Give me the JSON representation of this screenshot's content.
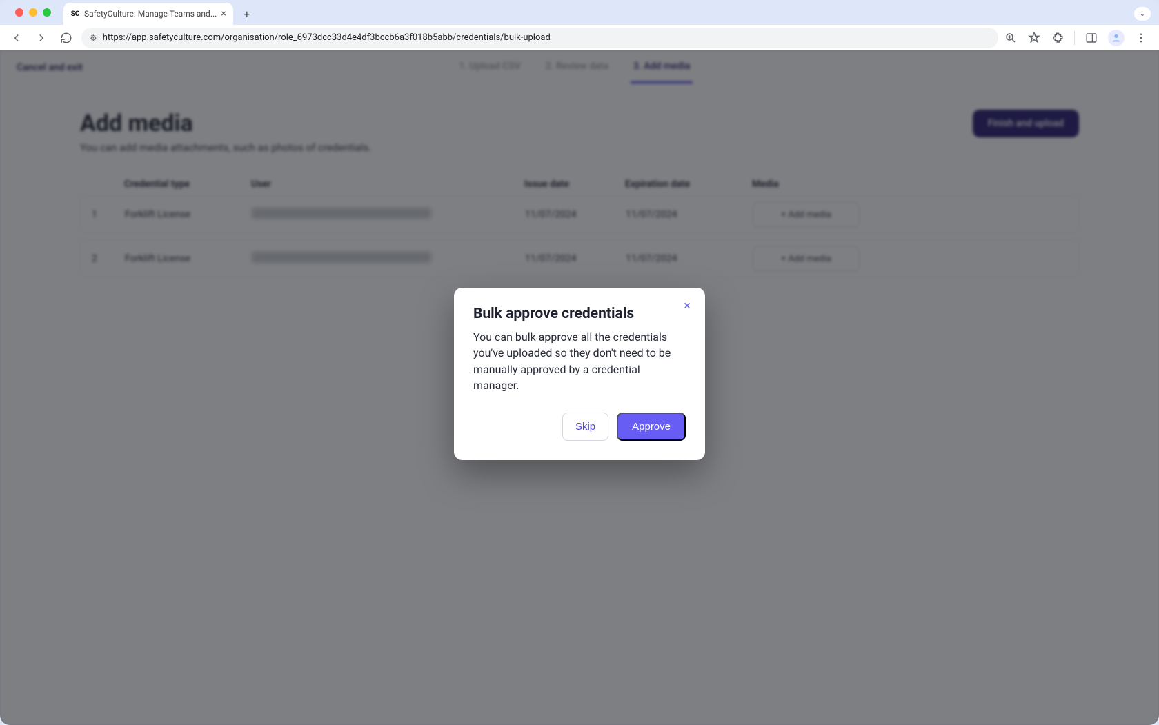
{
  "browser": {
    "tab_title": "SafetyCulture: Manage Teams and...",
    "url": "https://app.safetyculture.com/organisation/role_6973dcc33d4e4df3bccb6a3f018b5abb/credentials/bulk-upload"
  },
  "header": {
    "cancel": "Cancel and exit",
    "steps": [
      "1. Upload CSV",
      "2. Review data",
      "3. Add media"
    ],
    "active_step_index": 2
  },
  "page": {
    "title": "Add media",
    "subtitle": "You can add media attachments, such as photos of credentials.",
    "finish_btn": "Finish and upload"
  },
  "table": {
    "headers": {
      "type": "Credential type",
      "user": "User",
      "issue": "Issue date",
      "exp": "Expiration date",
      "media": "Media"
    },
    "rows": [
      {
        "idx": "1",
        "type": "Forklift License",
        "issue": "11/07/2024",
        "exp": "11/07/2024",
        "media_btn": "+ Add media"
      },
      {
        "idx": "2",
        "type": "Forklift License",
        "issue": "11/07/2024",
        "exp": "11/07/2024",
        "media_btn": "+ Add media"
      }
    ]
  },
  "modal": {
    "title": "Bulk approve credentials",
    "body": "You can bulk approve all the credentials you've uploaded so they don't need to be manually approved by a credential manager.",
    "skip": "Skip",
    "approve": "Approve"
  }
}
